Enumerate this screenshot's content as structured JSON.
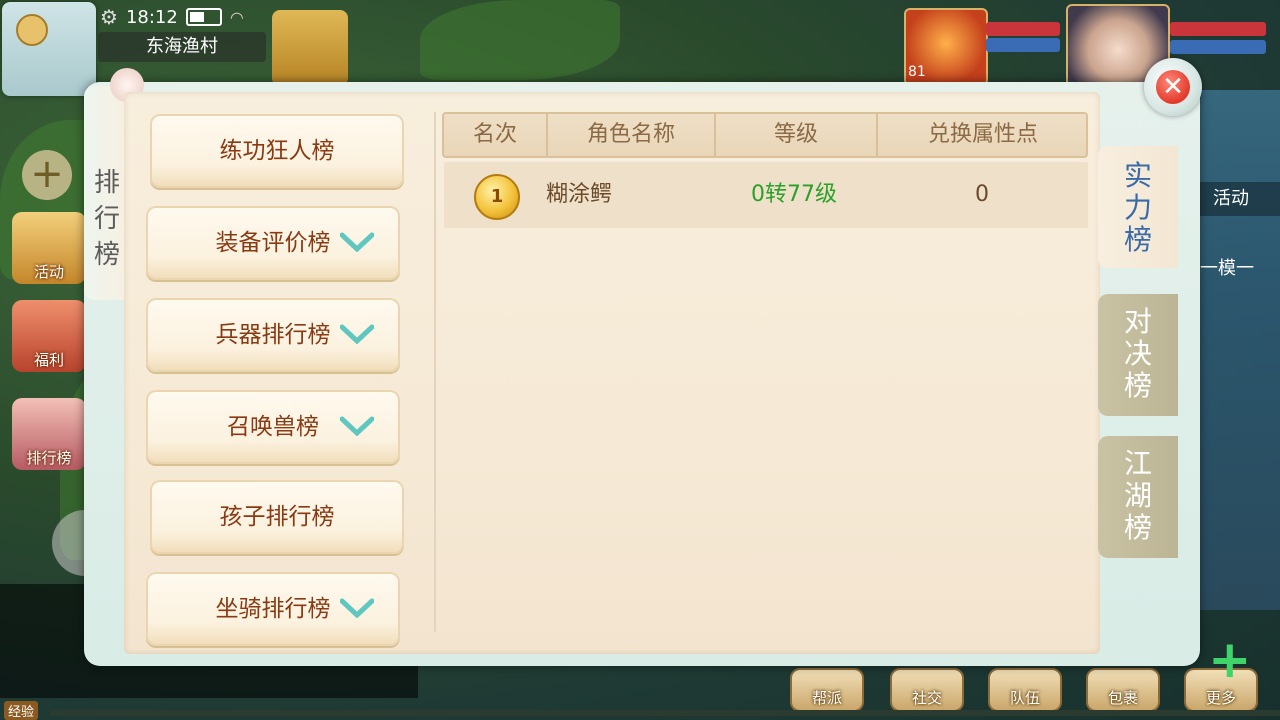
{
  "status": {
    "time": "18:12",
    "location": "东海渔村"
  },
  "pet": {
    "level": "81"
  },
  "side_menu": [
    {
      "label": "活动"
    },
    {
      "label": "福利"
    },
    {
      "label": "排行榜"
    }
  ],
  "right_peek": {
    "activity_tab": "活动",
    "task_text": "我一模一"
  },
  "bottom_menu": [
    {
      "label": "帮派"
    },
    {
      "label": "社交"
    },
    {
      "label": "队伍"
    },
    {
      "label": "包裹"
    },
    {
      "label": "更多"
    }
  ],
  "exp_label": "经验",
  "panel": {
    "title_chars": [
      "排",
      "行",
      "榜"
    ],
    "categories": [
      {
        "label": "练功狂人榜"
      },
      {
        "label": "装备评价榜"
      },
      {
        "label": "兵器排行榜"
      },
      {
        "label": "召唤兽榜"
      },
      {
        "label": "孩子排行榜"
      },
      {
        "label": "坐骑排行榜"
      }
    ],
    "table": {
      "headers": [
        "名次",
        "角色名称",
        "等级",
        "兑换属性点"
      ],
      "rows": [
        {
          "rank": "1",
          "name": "糊涂鳄",
          "level": "0转77级",
          "points": "0"
        }
      ]
    },
    "tabs": [
      {
        "label": "实力榜"
      },
      {
        "label": "对决榜"
      },
      {
        "label": "江湖榜"
      }
    ]
  },
  "colors": {
    "accent_green": "#2aa12a",
    "close_red": "#e23a2b",
    "chevron": "#5fc7c0"
  }
}
